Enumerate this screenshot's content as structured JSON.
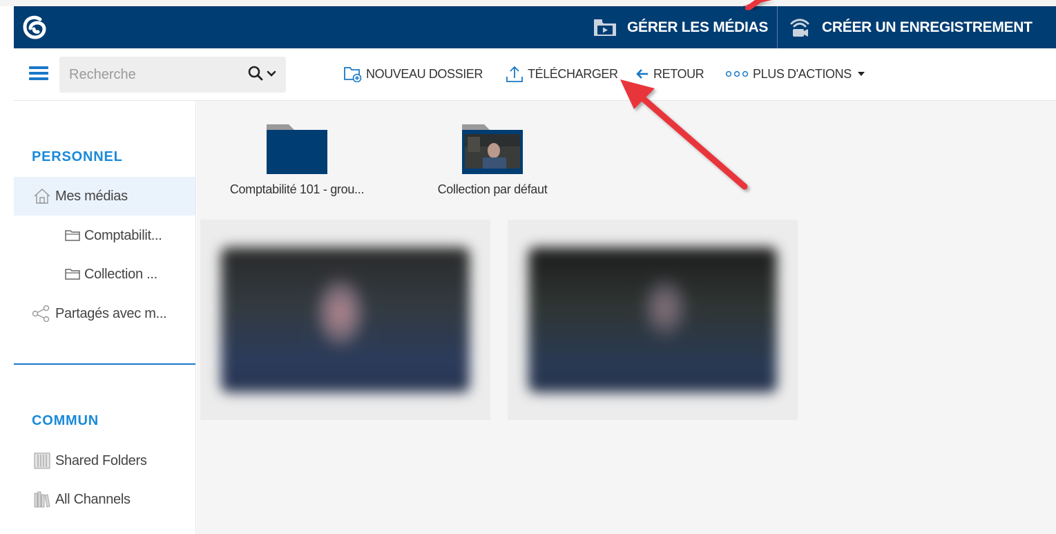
{
  "header": {
    "manage_media_label": "GÉRER LES MÉDIAS",
    "create_recording_label": "CRÉER UN ENREGISTREMENT",
    "bg_color": "#003d73"
  },
  "toolbar": {
    "search_placeholder": "Recherche",
    "new_folder_label": "NOUVEAU DOSSIER",
    "upload_label": "TÉLÉCHARGER",
    "back_label": "RETOUR",
    "more_actions_label": "PLUS D'ACTIONS"
  },
  "sidebar": {
    "personal_title": "PERSONNEL",
    "my_media_label": "Mes médias",
    "subfolder_1_label": "Comptabilit...",
    "subfolder_2_label": "Collection ...",
    "shared_with_me_label": "Partagés avec m...",
    "common_title": "COMMUN",
    "shared_folders_label": "Shared Folders",
    "all_channels_label": "All Channels",
    "accent_color": "#1a8ad8"
  },
  "content": {
    "folders": [
      {
        "name": "Comptabilité 101 - grou..."
      },
      {
        "name": "Collection par défaut"
      }
    ]
  },
  "annotation_color": "#e8353b"
}
